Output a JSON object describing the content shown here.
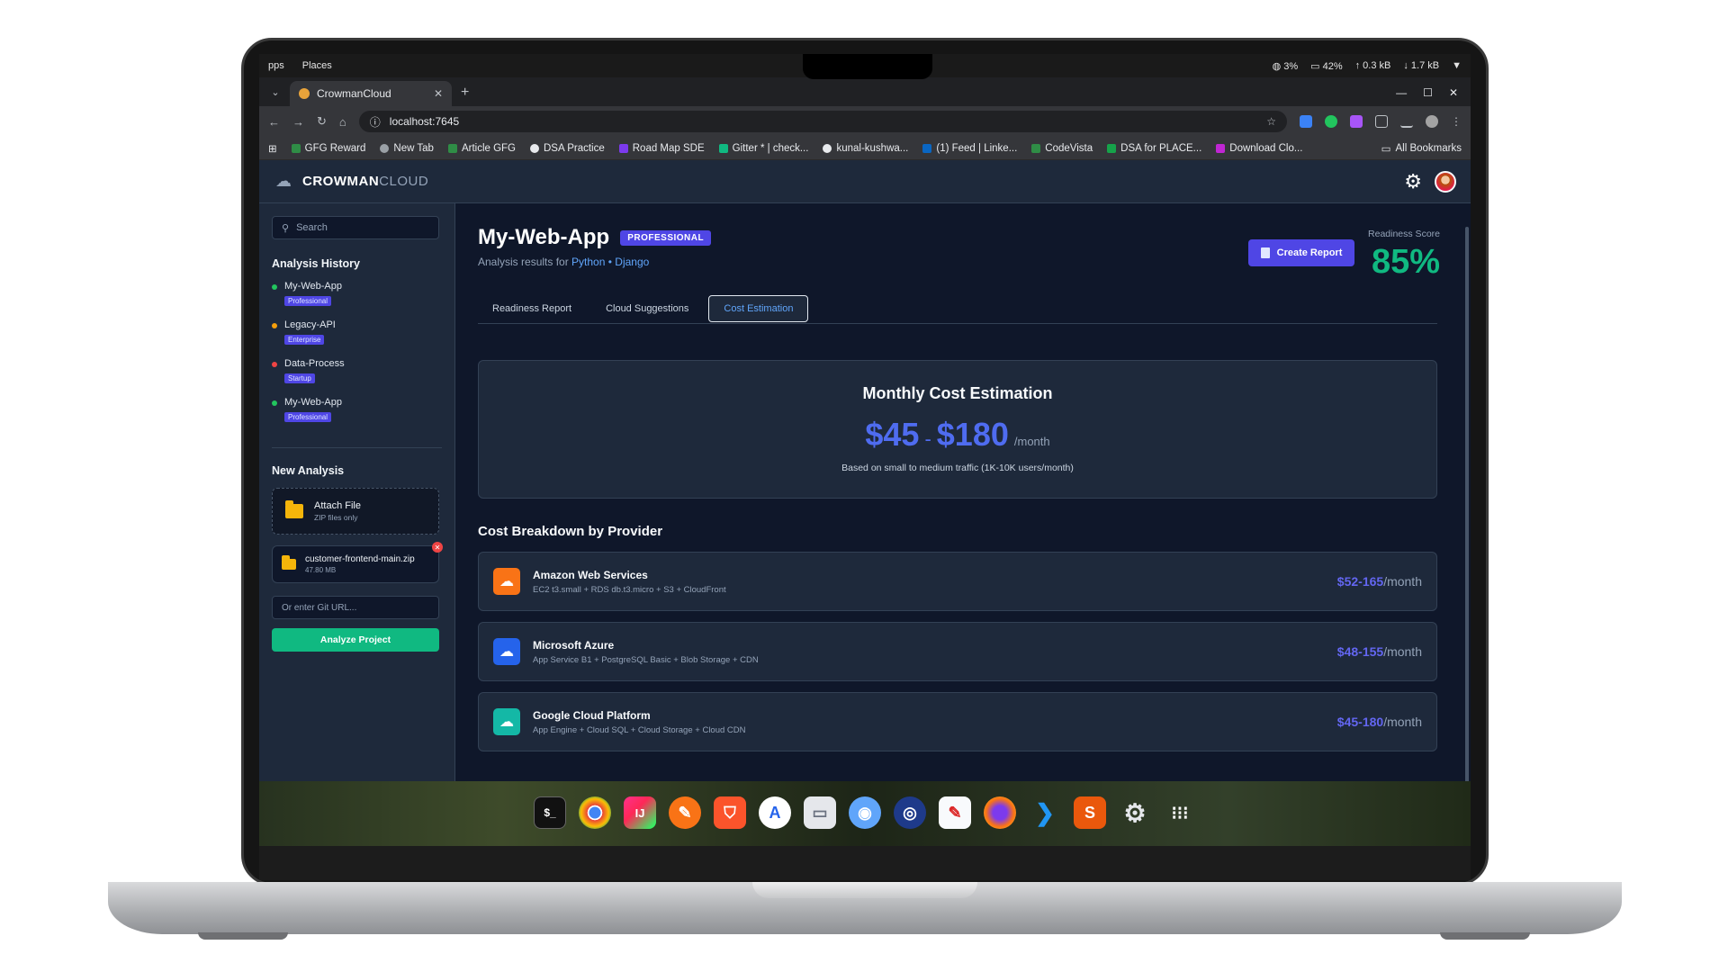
{
  "os": {
    "apps": "pps",
    "places": "Places",
    "cpu": "3%",
    "battery": "42%",
    "up": "0.3 kB",
    "down": "1.7 kB"
  },
  "browser": {
    "tab_title": "CrowmanCloud",
    "url": "localhost:7645",
    "bookmarks": [
      "GFG Reward",
      "New Tab",
      "Article GFG",
      "DSA Practice",
      "Road Map SDE",
      "Gitter * | check...",
      "kunal-kushwa...",
      "(1) Feed | Linke...",
      "CodeVista",
      "DSA for PLACE...",
      "Download Clo..."
    ],
    "all_bookmarks": "All Bookmarks"
  },
  "app": {
    "logo_bold": "CROWMAN",
    "logo_light": "CLOUD"
  },
  "sidebar": {
    "search_placeholder": "Search",
    "history_title": "Analysis History",
    "history": [
      {
        "name": "My-Web-App",
        "tier": "Professional",
        "status_color": "#22c55e"
      },
      {
        "name": "Legacy-API",
        "tier": "Enterprise",
        "status_color": "#f59e0b"
      },
      {
        "name": "Data-Process",
        "tier": "Startup",
        "status_color": "#ef4444"
      },
      {
        "name": "My-Web-App",
        "tier": "Professional",
        "status_color": "#22c55e"
      }
    ],
    "new_title": "New Analysis",
    "attach_title": "Attach File",
    "attach_sub": "ZIP files only",
    "file_name": "customer-frontend-main.zip",
    "file_size": "47.80 MB",
    "git_placeholder": "Or enter Git URL...",
    "analyze_label": "Analyze Project"
  },
  "main": {
    "project_title": "My-Web-App",
    "tier_badge": "PROFESSIONAL",
    "subtitle_prefix": "Analysis results for",
    "tech": "Python • Django",
    "create_report": "Create Report",
    "score_label": "Readiness Score",
    "score": "85%",
    "tabs": [
      "Readiness Report",
      "Cloud Suggestions",
      "Cost Estimation"
    ],
    "estimate": {
      "title": "Monthly Cost Estimation",
      "low": "$45",
      "dash": "-",
      "high": "$180",
      "unit": "/month",
      "note": "Based on small to medium traffic (1K-10K users/month)"
    },
    "breakdown_title": "Cost Breakdown by Provider",
    "providers": [
      {
        "name": "Amazon Web Services",
        "desc": "EC2 t3.small + RDS db.t3.micro + S3 + CloudFront",
        "price": "$52-165",
        "per": "/month",
        "color": "#f97316"
      },
      {
        "name": "Microsoft Azure",
        "desc": "App Service B1 + PostgreSQL Basic + Blob Storage + CDN",
        "price": "$48-155",
        "per": "/month",
        "color": "#2563eb"
      },
      {
        "name": "Google Cloud Platform",
        "desc": "App Engine + Cloud SQL + Cloud Storage + Cloud CDN",
        "price": "$45-180",
        "per": "/month",
        "color": "#14b8a6"
      }
    ]
  },
  "icons": {
    "cloud": "☁",
    "gear": "⚙",
    "search": "🔍"
  }
}
